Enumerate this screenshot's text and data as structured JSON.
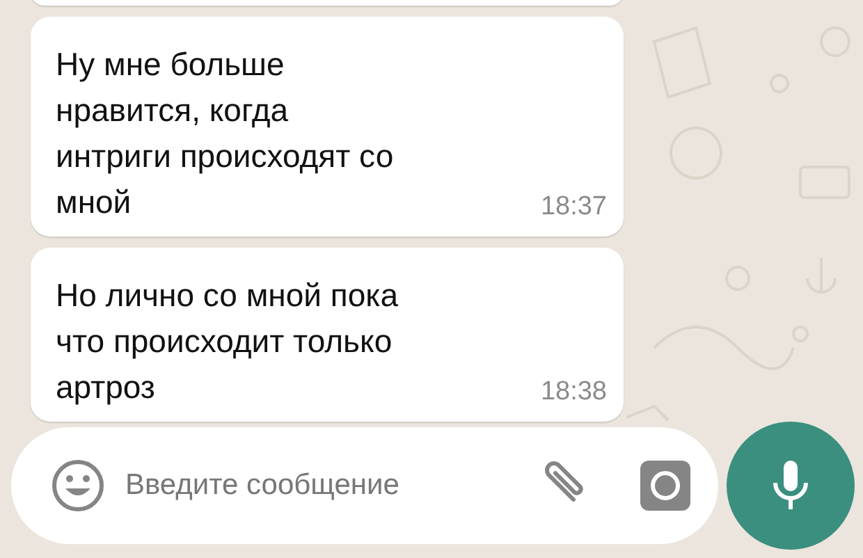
{
  "messages": [
    {
      "kind": "partial"
    },
    {
      "kind": "full",
      "text": "Ну мне больше\nнравится, когда\nинтриги происходят со\nмной",
      "time": "18:37"
    },
    {
      "kind": "full",
      "text": "Но лично со мной пока\nчто происходит только\nартроз",
      "time": "18:38"
    }
  ],
  "composer": {
    "placeholder": "Введите сообщение"
  }
}
